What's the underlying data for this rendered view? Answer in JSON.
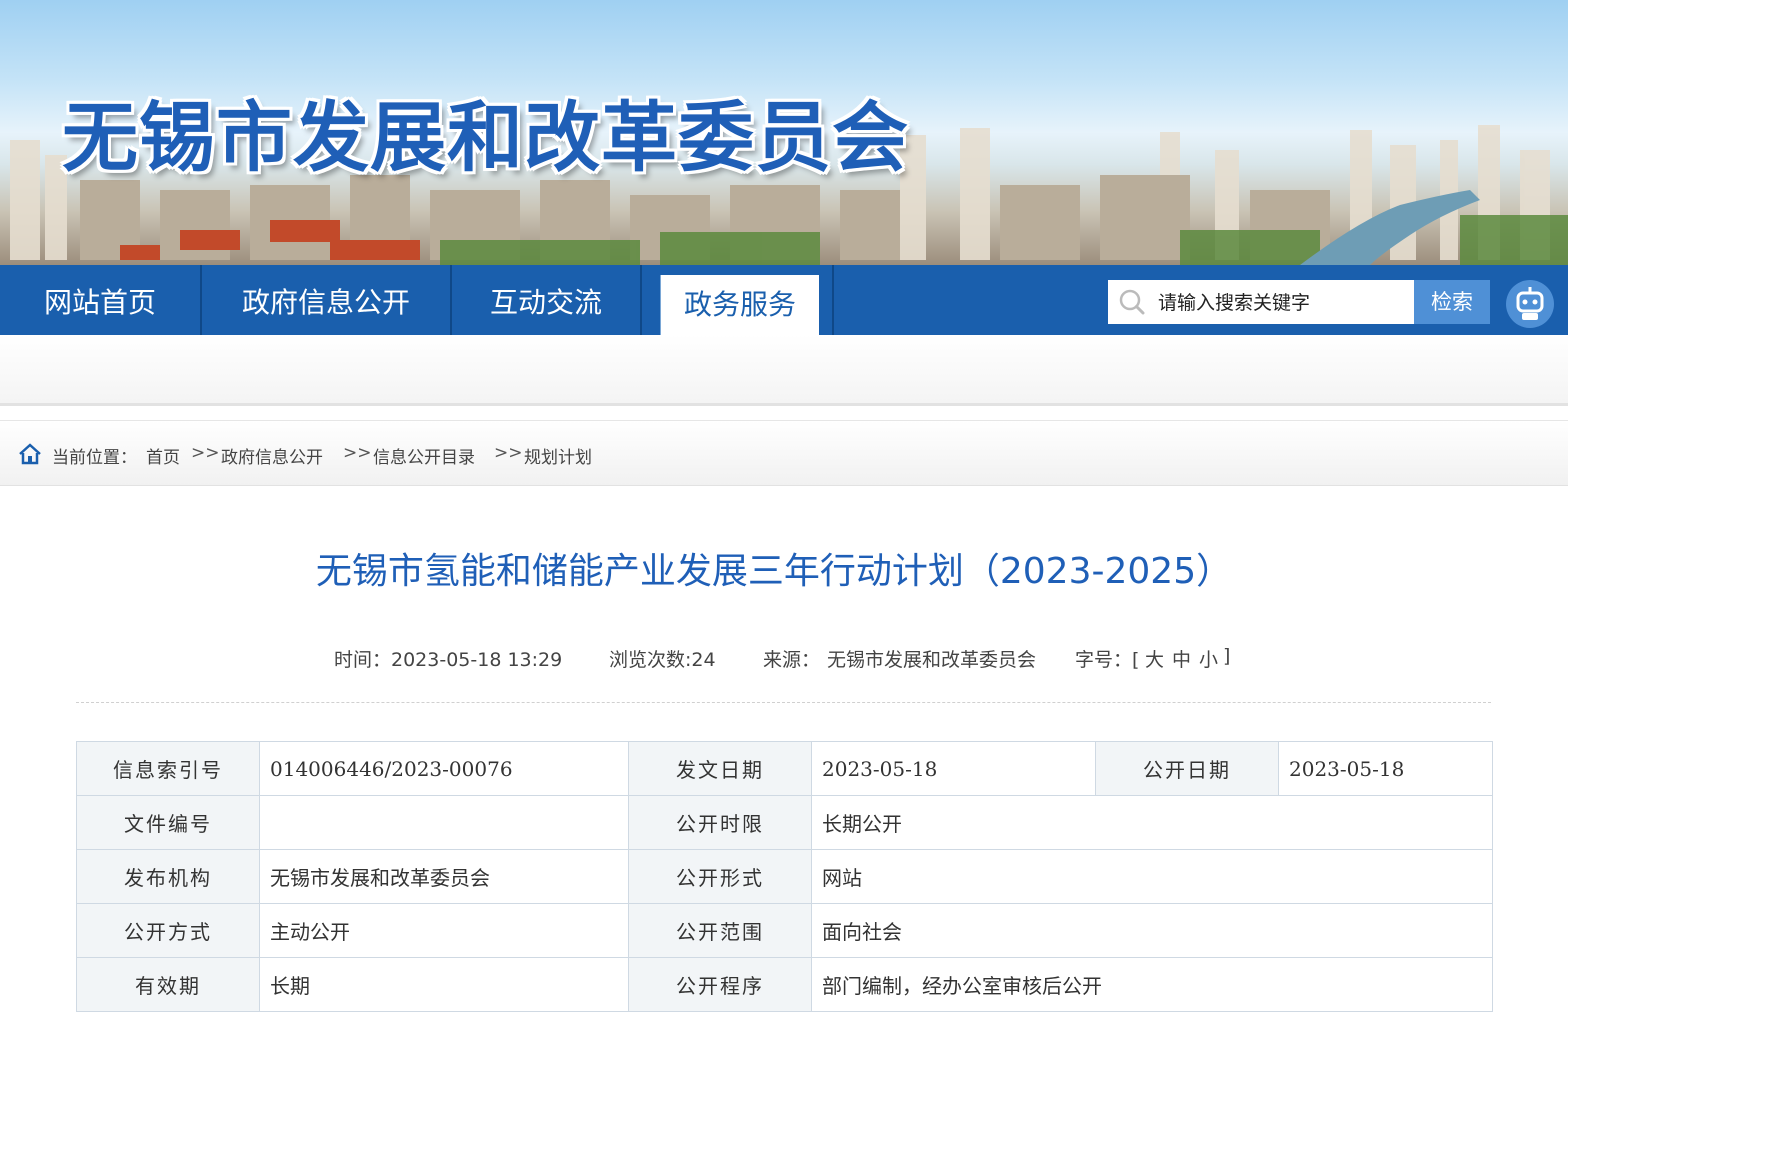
{
  "header": {
    "site_title": "无锡市发展和改革委员会"
  },
  "nav": {
    "items": [
      {
        "label": "网站首页"
      },
      {
        "label": "政府信息公开"
      },
      {
        "label": "互动交流"
      },
      {
        "label": "政务服务"
      }
    ],
    "active_index": 3,
    "search_placeholder": "请输入搜索关键字",
    "search_button": "检索",
    "assistant_icon": "robot-icon"
  },
  "breadcrumb": {
    "prefix": "当前位置：",
    "items": [
      "首页",
      "政府信息公开",
      "信息公开目录",
      "规划计划"
    ],
    "separator": ">>"
  },
  "article": {
    "title": "无锡市氢能和储能产业发展三年行动计划（2023-2025）",
    "meta": {
      "time": "时间：2023-05-18 13:29",
      "views": "浏览次数:24",
      "source_label": "来源：",
      "source": "无锡市发展和改革委员会",
      "font_size_label": "字号：[",
      "font_large": "大",
      "font_medium": "中",
      "font_small": "小",
      "font_close": "]"
    }
  },
  "info_table": {
    "row0": {
      "l1": "信息索引号",
      "v1": "014006446/2023-00076",
      "l2": "发文日期",
      "v2": "2023-05-18",
      "l3": "公开日期",
      "v3": "2023-05-18"
    },
    "row1": {
      "l1": "文件编号",
      "v1": "",
      "l2": "公开时限",
      "v2": "长期公开"
    },
    "row2": {
      "l1": "发布机构",
      "v1": "无锡市发展和改革委员会",
      "l2": "公开形式",
      "v2": "网站"
    },
    "row3": {
      "l1": "公开方式",
      "v1": "主动公开",
      "l2": "公开范围",
      "v2": "面向社会"
    },
    "row4": {
      "l1": "有效期",
      "v1": "长期",
      "l2": "公开程序",
      "v2": "部门编制，经办公室审核后公开"
    }
  },
  "colors": {
    "brand_blue": "#1a5fad",
    "title_blue": "#1f5fb7",
    "search_button": "#4f90d6"
  }
}
